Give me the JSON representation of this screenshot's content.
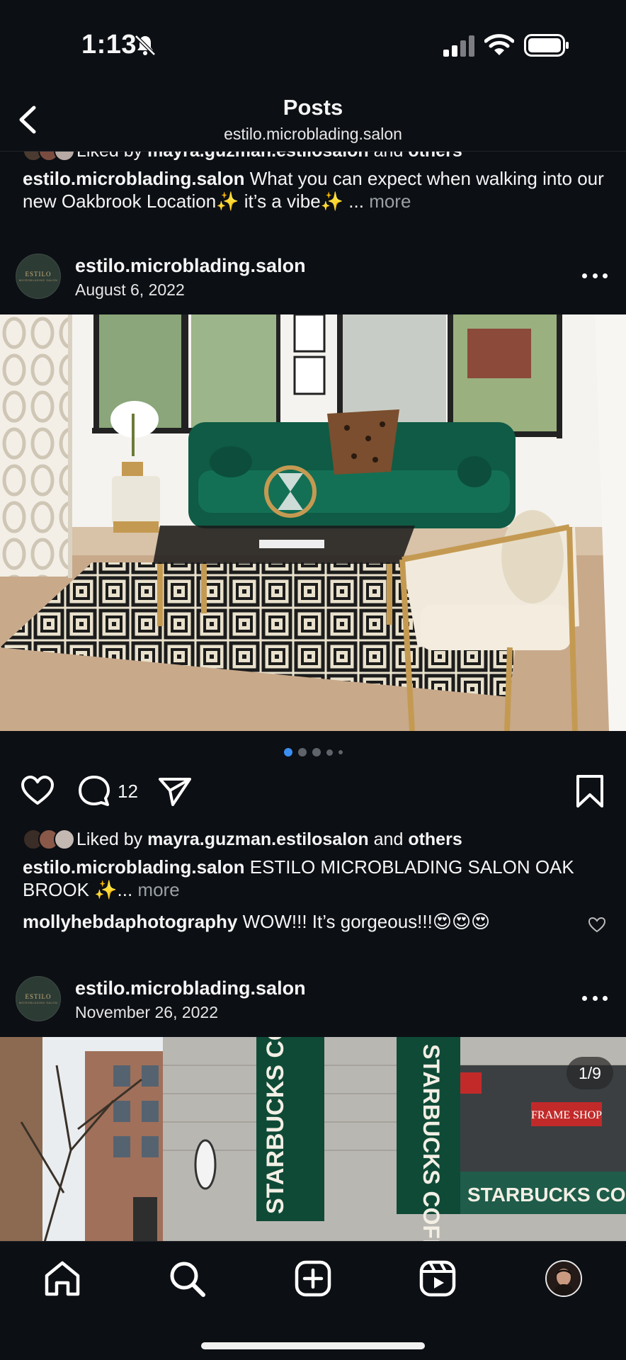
{
  "status_bar": {
    "time": "1:13",
    "icons": [
      "bell-off-icon",
      "signal-icon",
      "wifi-icon",
      "battery-icon"
    ]
  },
  "header": {
    "title": "Posts",
    "subtitle": "estilo.microblading.salon",
    "back_icon": "chevron-left-icon"
  },
  "prev_post": {
    "liked_prefix": "Liked by",
    "liked_user": "mayra.guzman.estilosalon",
    "liked_and": "and",
    "liked_others": "others",
    "caption_user": "estilo.microblading.salon",
    "caption_text": "What you can expect when walking into our new Oakbrook Location✨ it’s a vibe✨ ...",
    "more_label": "more"
  },
  "post1": {
    "username": "estilo.microblading.salon",
    "date": "August 6, 2022",
    "avatar_text": "ESTILO",
    "avatar_subtext": "MICROBLADING SALON",
    "carousel_count": 5,
    "carousel_active": 1,
    "comment_count": "12",
    "liked_prefix": "Liked by",
    "liked_user": "mayra.guzman.estilosalon",
    "liked_and": "and",
    "liked_others": "others",
    "caption_user": "estilo.microblading.salon",
    "caption_text": "ESTILO MICROBLADING SALON OAK BROOK ✨...",
    "more_label": "more",
    "top_comment": {
      "user": "mollyhebdaphotography",
      "text": "WOW!!! It’s gorgeous!!!😍😍😍"
    }
  },
  "post2": {
    "username": "estilo.microblading.salon",
    "date": "November 26, 2022",
    "avatar_text": "ESTILO",
    "avatar_subtext": "MICROBLADING SALON",
    "counter": "1/9",
    "banner_text": "STARBUCKS COFFEE",
    "storefront_sign": "STARBUCKS COFFEE",
    "shop_sign": "FRAME SHOP"
  },
  "tab_bar": {
    "tabs": [
      "home-icon",
      "search-icon",
      "create-icon",
      "reels-icon",
      "profile-avatar"
    ]
  },
  "colors": {
    "background": "#0c0f14",
    "text": "#f5f5f5",
    "muted": "#9aa0a6",
    "active_dot": "#3b8ff0",
    "sofa_green": "#0f5b45"
  }
}
